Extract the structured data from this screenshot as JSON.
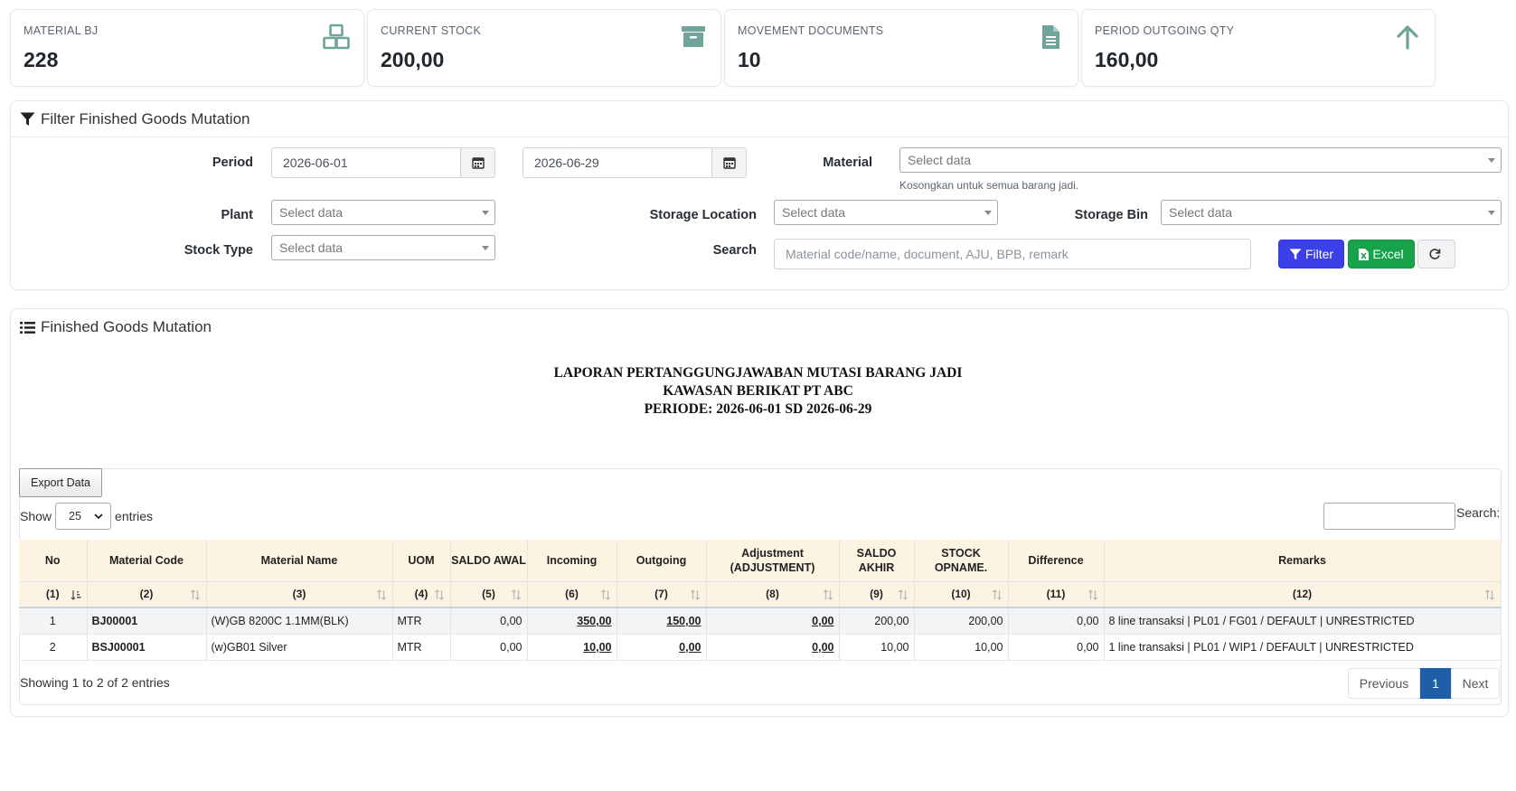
{
  "stats": [
    {
      "label": "MATERIAL BJ",
      "value": "228",
      "icon": "cubes-icon"
    },
    {
      "label": "CURRENT STOCK",
      "value": "200,00",
      "icon": "archive-icon"
    },
    {
      "label": "MOVEMENT DOCUMENTS",
      "value": "10",
      "icon": "document-icon"
    },
    {
      "label": "PERIOD OUTGOING QTY",
      "value": "160,00",
      "icon": "arrow-up-icon"
    }
  ],
  "colors": {
    "icon": "#6ea49a",
    "filter_btn": "#3b3fe8",
    "excel_btn": "#16a34a",
    "link": "#1f6a5e",
    "header_bg": "#fdf3e3",
    "page_active": "#1f5fa8"
  },
  "filter": {
    "title": "Filter Finished Goods Mutation",
    "period_label": "Period",
    "date_from": "2026-06-01",
    "date_to": "2026-06-29",
    "material_label": "Material",
    "material_placeholder": "Select data",
    "material_hint": "Kosongkan untuk semua barang jadi.",
    "plant_label": "Plant",
    "plant_placeholder": "Select data",
    "storage_location_label": "Storage Location",
    "storage_location_placeholder": "Select data",
    "storage_bin_label": "Storage Bin",
    "storage_bin_placeholder": "Select data",
    "stock_type_label": "Stock Type",
    "stock_type_placeholder": "Select data",
    "search_label": "Search",
    "search_placeholder": "Material code/name, document, AJU, BPB, remark",
    "filter_button": "Filter",
    "excel_button": "Excel"
  },
  "report": {
    "panel_title": "Finished Goods Mutation",
    "title_line1": "LAPORAN PERTANGGUNGJAWABAN MUTASI BARANG JADI",
    "title_line2": "KAWASAN BERIKAT PT ABC",
    "title_line3": "PERIODE: 2026-06-01 SD 2026-06-29",
    "export_button": "Export Data",
    "show_label": "Show",
    "entries_value": "25",
    "entries_label": "entries",
    "search_label": "Search:",
    "info": "Showing 1 to 2 of 2 entries",
    "previous": "Previous",
    "page": "1",
    "next": "Next"
  },
  "table": {
    "headers": [
      "No",
      "Material Code",
      "Material Name",
      "UOM",
      "SALDO AWAL",
      "Incoming",
      "Outgoing",
      "Adjustment (ADJUSTMENT)",
      "SALDO AKHIR",
      "STOCK OPNAME.",
      "Difference",
      "Remarks"
    ],
    "subheaders": [
      "(1)",
      "(2)",
      "(3)",
      "(4)",
      "(5)",
      "(6)",
      "(7)",
      "(8)",
      "(9)",
      "(10)",
      "(11)",
      "(12)"
    ],
    "rows": [
      {
        "no": "1",
        "code": "BJ00001",
        "name": "(W)GB 8200C 1.1MM(BLK)",
        "uom": "MTR",
        "saldo_awal": "0,00",
        "incoming": "350,00",
        "outgoing": "150,00",
        "adjustment": "0,00",
        "saldo_akhir": "200,00",
        "stock_opname": "200,00",
        "difference": "0,00",
        "remarks": "8 line transaksi | PL01 / FG01 / DEFAULT | UNRESTRICTED"
      },
      {
        "no": "2",
        "code": "BSJ00001",
        "name": "(w)GB01 Silver",
        "uom": "MTR",
        "saldo_awal": "0,00",
        "incoming": "10,00",
        "outgoing": "0,00",
        "adjustment": "0,00",
        "saldo_akhir": "10,00",
        "stock_opname": "10,00",
        "difference": "0,00",
        "remarks": "1 line transaksi | PL01 / WIP1 / DEFAULT | UNRESTRICTED"
      }
    ]
  }
}
